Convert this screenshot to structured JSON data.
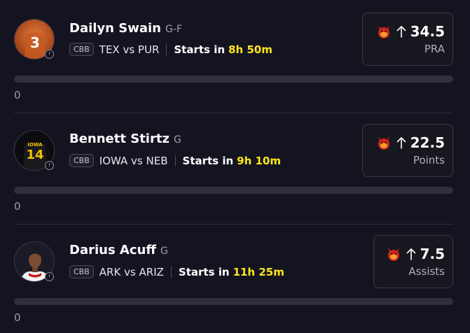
{
  "players": [
    {
      "name": "Dailyn Swain",
      "position": "G-F",
      "league": "CBB",
      "matchup": "TEX vs PUR",
      "starts_label": "Starts in",
      "countdown": "8h 50m",
      "line": "34.5",
      "stat": "PRA",
      "jersey_number": "3",
      "count": "0",
      "progress": 0
    },
    {
      "name": "Bennett Stirtz",
      "position": "G",
      "league": "CBB",
      "matchup": "IOWA vs NEB",
      "starts_label": "Starts in",
      "countdown": "9h 10m",
      "line": "22.5",
      "stat": "Points",
      "jersey_number": "14",
      "jersey_text": "IOWA",
      "count": "0",
      "progress": 0
    },
    {
      "name": "Darius Acuff",
      "position": "G",
      "league": "CBB",
      "matchup": "ARK vs ARIZ",
      "starts_label": "Starts in",
      "countdown": "11h 25m",
      "line": "7.5",
      "stat": "Assists",
      "count": "0",
      "progress": 0
    }
  ],
  "colors": {
    "background": "#141421",
    "countdown": "#ffe81a",
    "track": "#2f2f3d",
    "devil": "#d0261a"
  },
  "icons": [
    "devil-icon",
    "arrow-up-icon",
    "clock-icon"
  ]
}
